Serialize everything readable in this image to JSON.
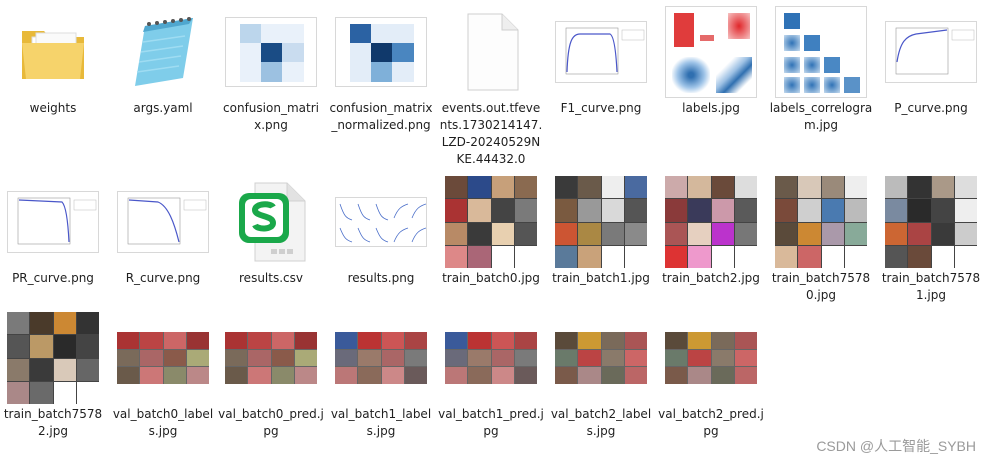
{
  "files": [
    {
      "name": "weights",
      "type": "folder"
    },
    {
      "name": "args.yaml",
      "type": "notepad"
    },
    {
      "name": "confusion_matrix.png",
      "type": "confusion"
    },
    {
      "name": "confusion_matrix_normalized.png",
      "type": "confusion"
    },
    {
      "name": "events.out.tfevents.1730214147.LZD-20240529NKE.44432.0",
      "type": "blank-doc"
    },
    {
      "name": "F1_curve.png",
      "type": "curve"
    },
    {
      "name": "labels.jpg",
      "type": "labels"
    },
    {
      "name": "labels_correlogram.jpg",
      "type": "correlogram"
    },
    {
      "name": "P_curve.png",
      "type": "curve"
    },
    {
      "name": "PR_curve.png",
      "type": "curve"
    },
    {
      "name": "R_curve.png",
      "type": "curve"
    },
    {
      "name": "results.csv",
      "type": "csv"
    },
    {
      "name": "results.png",
      "type": "results"
    },
    {
      "name": "train_batch0.jpg",
      "type": "mosaic"
    },
    {
      "name": "train_batch1.jpg",
      "type": "mosaic"
    },
    {
      "name": "train_batch2.jpg",
      "type": "mosaic"
    },
    {
      "name": "train_batch75780.jpg",
      "type": "mosaic"
    },
    {
      "name": "train_batch75781.jpg",
      "type": "mosaic"
    },
    {
      "name": "train_batch75782.jpg",
      "type": "mosaic"
    },
    {
      "name": "val_batch0_labels.jpg",
      "type": "val"
    },
    {
      "name": "val_batch0_pred.jpg",
      "type": "val"
    },
    {
      "name": "val_batch1_labels.jpg",
      "type": "val"
    },
    {
      "name": "val_batch1_pred.jpg",
      "type": "val"
    },
    {
      "name": "val_batch2_labels.jpg",
      "type": "val"
    },
    {
      "name": "val_batch2_pred.jpg",
      "type": "val"
    }
  ],
  "watermark": "CSDN @人工智能_SYBH",
  "colors": {
    "folder": "#f3c84b",
    "csv": "#1aa84a",
    "confusion": "#1f4f8a"
  }
}
